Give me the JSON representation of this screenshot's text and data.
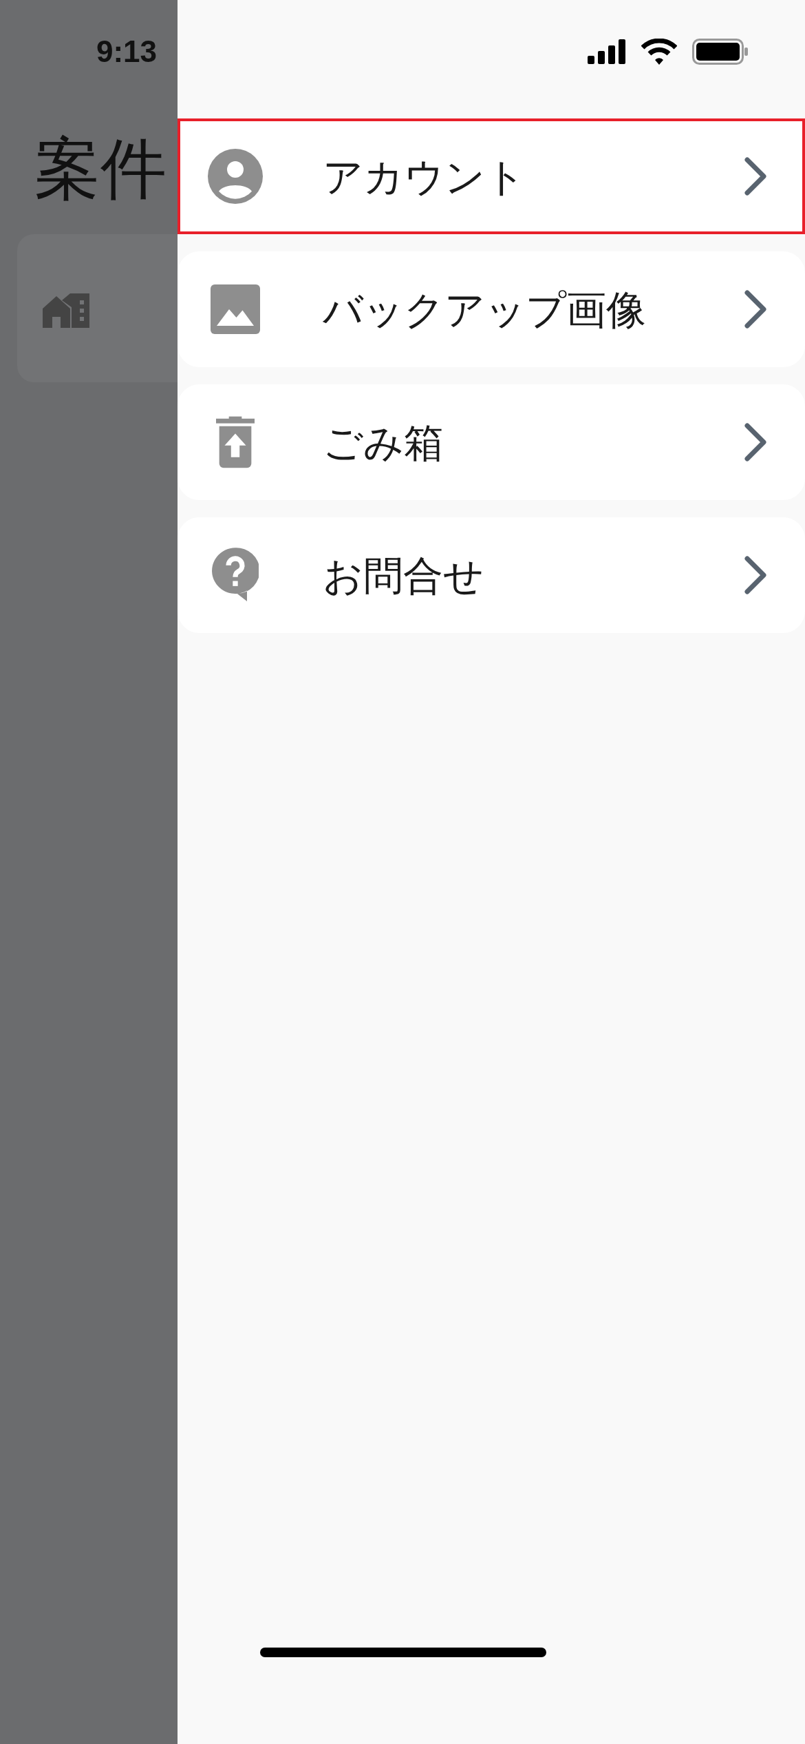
{
  "background": {
    "status_time": "9:13",
    "title": "案件"
  },
  "drawer": {
    "items": [
      {
        "kind": "account",
        "label": "アカウント",
        "highlighted": true
      },
      {
        "kind": "image",
        "label": "バックアップ画像",
        "highlighted": false
      },
      {
        "kind": "trash",
        "label": "ごみ箱",
        "highlighted": false
      },
      {
        "kind": "help",
        "label": "お問合せ",
        "highlighted": false
      }
    ]
  }
}
